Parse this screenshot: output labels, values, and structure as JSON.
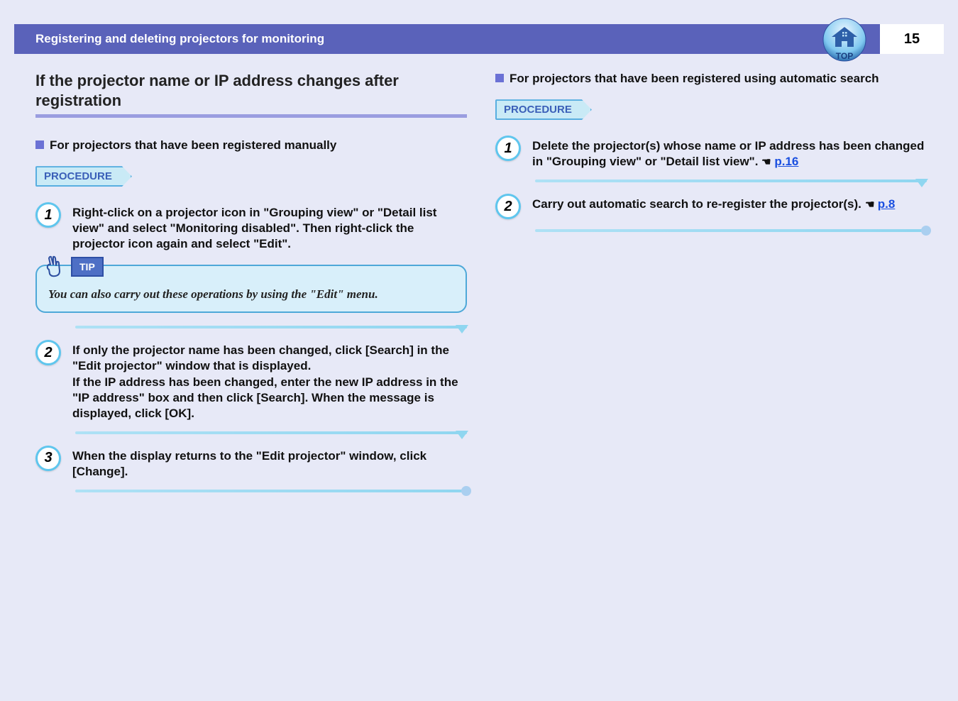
{
  "header": {
    "title": "Registering and deleting projectors for monitoring",
    "page_number": "15",
    "top_label": "TOP"
  },
  "left": {
    "heading": "If the projector name or IP address changes after registration",
    "sub": "For projectors that have been registered manually",
    "procedure_label": "PROCEDURE",
    "steps": {
      "s1": "Right-click on a projector icon in \"Grouping view\" or \"Detail list view\" and select \"Monitoring disabled\". Then right-click the projector icon again and select \"Edit\".",
      "s2": "If only the projector name has been changed, click [Search] in the \"Edit projector\" window that is displayed.\nIf the IP address has been changed, enter the new IP address in the \"IP address\" box and then click [Search]. When the message is displayed, click [OK].",
      "s3": "When the display returns to the \"Edit projector\" window, click [Change]."
    },
    "tip_label": "TIP",
    "tip_text": "You can also carry out these operations by using the \"Edit\" menu."
  },
  "right": {
    "sub": "For projectors that have been registered using automatic search",
    "procedure_label": "PROCEDURE",
    "steps": {
      "s1_a": "Delete the projector(s) whose name or IP address has been changed in \"Grouping view\" or \"Detail list view\". ",
      "s1_ref": "p.16",
      "s2_a": "Carry out automatic search to re-register the projector(s). ",
      "s2_ref": "p.8"
    }
  }
}
